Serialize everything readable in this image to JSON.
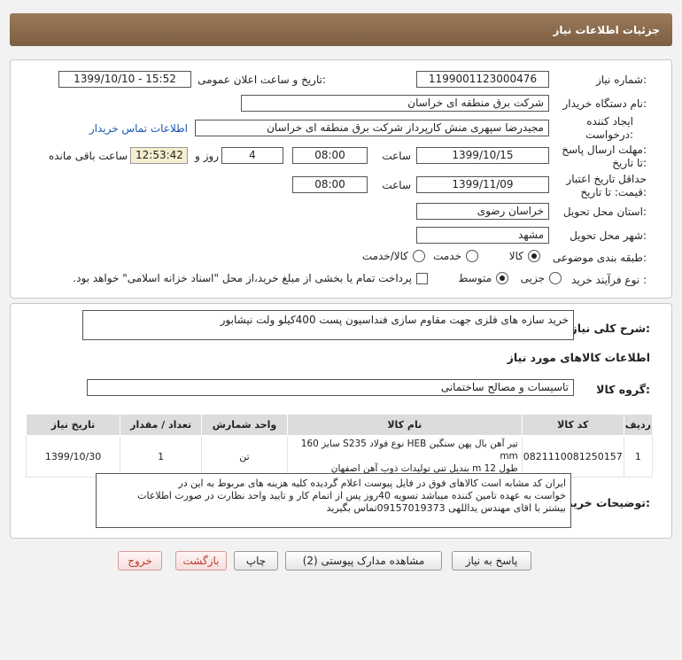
{
  "header": {
    "title": "جزئیات اطلاعات نیاز"
  },
  "info": {
    "need_number_label": "شماره نیاز:",
    "need_number": "1199001123000476",
    "announce_label": "تاریخ و ساعت اعلان عمومی:",
    "announce_value": "1399/10/10 - 15:52",
    "buyer_org_label": "نام دستگاه خریدار:",
    "buyer_org": "شرکت برق منطقه ای خراسان",
    "creator_label_1": "ایجاد کننده",
    "creator_label_2": "درخواست:",
    "creator": "مجیدرضا سپهری منش کارپرداز شرکت برق منطقه ای خراسان",
    "contact_link": "اطلاعات تماس خریدار",
    "reply_label_1": "مهلت ارسال پاسخ:",
    "reply_label_2": "تا تاریخ:",
    "reply_date": "1399/10/15",
    "time_label": "ساعت",
    "reply_time": "08:00",
    "day_label": "روز و",
    "days": "4",
    "remaining_time": "12:53:42",
    "remaining_label": "ساعت باقی مانده",
    "validity_label_1": "حداقل تاریخ اعتبار",
    "validity_label_2": "قیمت: تا تاریخ:",
    "validity_date": "1399/11/09",
    "validity_time": "08:00",
    "province_label": "استان محل تحویل:",
    "province": "خراسان رضوی",
    "city_label": "شهر محل تحویل:",
    "city": "مشهد",
    "category_label": "طبقه بندی موضوعی:",
    "category_options": [
      "کالا",
      "خدمت",
      "کالا/خدمت"
    ],
    "process_label": "نوع فرآیند خرید :",
    "process_options": [
      "جزیی",
      "متوسط"
    ],
    "payment_note": "پرداخت تمام یا بخشی از مبلغ خرید،از محل \"اسناد خزانه اسلامی\" خواهد بود."
  },
  "details": {
    "summary_label": "شرح کلی نیاز:",
    "summary": "خرید سازه های فلزی جهت مقاوم سازی فنداسیون پست 400کیلو ولت نیشابور",
    "goods_heading": "اطلاعات کالاهای مورد نیاز",
    "group_label": "گروه کالا:",
    "group": "تاسیسات و مصالح ساختمانی",
    "table": {
      "headers": [
        "ردیف",
        "کد کالا",
        "نام کالا",
        "واحد شمارش",
        "تعداد / مقدار",
        "تاریخ نیاز"
      ],
      "rows": [
        {
          "row": "1",
          "code": "0821110081250157",
          "name_line1": "تیر آهن بال پهن سنگین HEB نوع فولاد S235 سایز 160 mm",
          "name_line2": "طول m 12 بندیل تنی تولیدات ذوب آهن اصفهان",
          "unit": "تن",
          "qty": "1",
          "date": "1399/10/30"
        }
      ]
    },
    "notes_label": "توضیحات خریدار:",
    "notes_line1": "ایران کد مشابه است کالاهای  فوق در فایل پیوست اعلام گردیده کلیه هزینه های مربوط به این در",
    "notes_line2": "خواست به عهده تامین کننده میباشد تسویه 40روز پس از اتمام کار و تایید واحد نظارت در صورت اطلاعات",
    "notes_line3": "بیشتر با اقای مهندس یداللهی 09157019373تماس بگیرید"
  },
  "buttons": {
    "reply": "پاسخ به نیاز",
    "view_docs": "مشاهده مدارک پیوستی (2)",
    "print": "چاپ",
    "back": "بازگشت",
    "exit": "خروج"
  }
}
